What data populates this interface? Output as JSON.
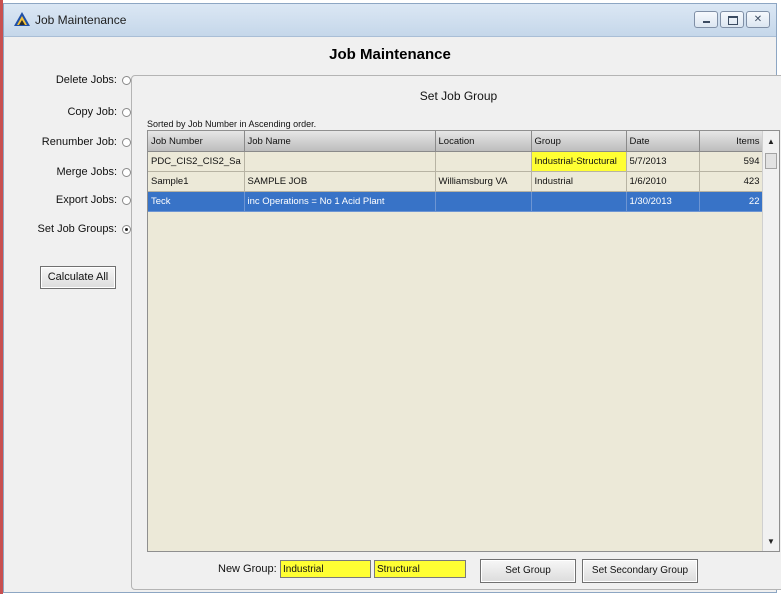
{
  "window": {
    "title": "Job Maintenance",
    "icon": "app-logo-icon",
    "controls": [
      "minimize-icon",
      "maximize-icon",
      "close-icon"
    ],
    "close_glyph": "✕"
  },
  "heading": "Job Maintenance",
  "options": [
    {
      "label": "Delete Jobs:",
      "checked": false
    },
    {
      "label": "Copy Job:",
      "checked": false
    },
    {
      "label": "Renumber Job:",
      "checked": false
    },
    {
      "label": "Merge Jobs:",
      "checked": false
    },
    {
      "label": "Export Jobs:",
      "checked": false
    },
    {
      "label": "Set Job Groups:",
      "checked": true
    }
  ],
  "calculate_label": "Calculate All",
  "panel": {
    "title": "Set Job Group",
    "sort_note": "Sorted by Job Number in Ascending order.",
    "columns": [
      "Job Number",
      "Job Name",
      "Location",
      "Group",
      "Date",
      "Items"
    ],
    "rows": [
      [
        "PDC_CIS2_CIS2_Sa",
        "",
        "",
        "Industrial-Structural",
        "5/7/2013",
        "594"
      ],
      [
        "Sample1",
        "SAMPLE JOB",
        "Williamsburg VA",
        "Industrial",
        "1/6/2010",
        "423"
      ],
      [
        "Teck",
        "inc Operations = No 1 Acid Plant",
        "",
        "",
        "1/30/2013",
        "22"
      ]
    ],
    "selected_row": 2,
    "highlighted_cell": {
      "row": 0,
      "col": 3
    },
    "highlight_color": "#ffff33",
    "selection_color": "#3873c7"
  },
  "bottom": {
    "new_group_label": "New Group:",
    "group_value": "Industrial",
    "secondary_value": "Structural",
    "set_group_label": "Set Group",
    "set_secondary_label": "Set Secondary Group"
  },
  "scrollbar": {
    "up_glyph": "▲",
    "down_glyph": "▼"
  }
}
